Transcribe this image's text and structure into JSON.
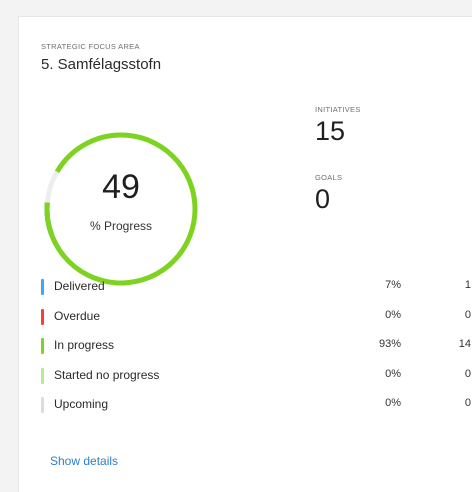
{
  "card": {
    "eyebrow": "STRATEGIC FOCUS AREA",
    "title": "5. Samfélagsstofn"
  },
  "progress": {
    "value": "49",
    "caption": "% Progress",
    "percent": 49,
    "segments": [
      {
        "status": "delivered",
        "fraction": 0.07,
        "color": "#42a5f5"
      },
      {
        "status": "in-progress",
        "fraction": 0.93,
        "color": "#7ed321"
      }
    ]
  },
  "stats": {
    "initiatives": {
      "label": "INITIATIVES",
      "value": "15"
    },
    "goals": {
      "label": "GOALS",
      "value": "0"
    }
  },
  "status_rows": [
    {
      "key": "delivered",
      "label": "Delivered",
      "percent": "7%",
      "count": "1",
      "color": "#42a5f5"
    },
    {
      "key": "overdue",
      "label": "Overdue",
      "percent": "0%",
      "count": "0",
      "color": "#f44336"
    },
    {
      "key": "in-progress",
      "label": "In progress",
      "percent": "93%",
      "count": "14",
      "color": "#7ed321"
    },
    {
      "key": "started-no-progress",
      "label": "Started no progress",
      "percent": "0%",
      "count": "0",
      "color": "#b5ec8c"
    },
    {
      "key": "upcoming",
      "label": "Upcoming",
      "percent": "0%",
      "count": "0",
      "color": "#dcdcdc"
    }
  ],
  "actions": {
    "show_details": "Show details"
  }
}
